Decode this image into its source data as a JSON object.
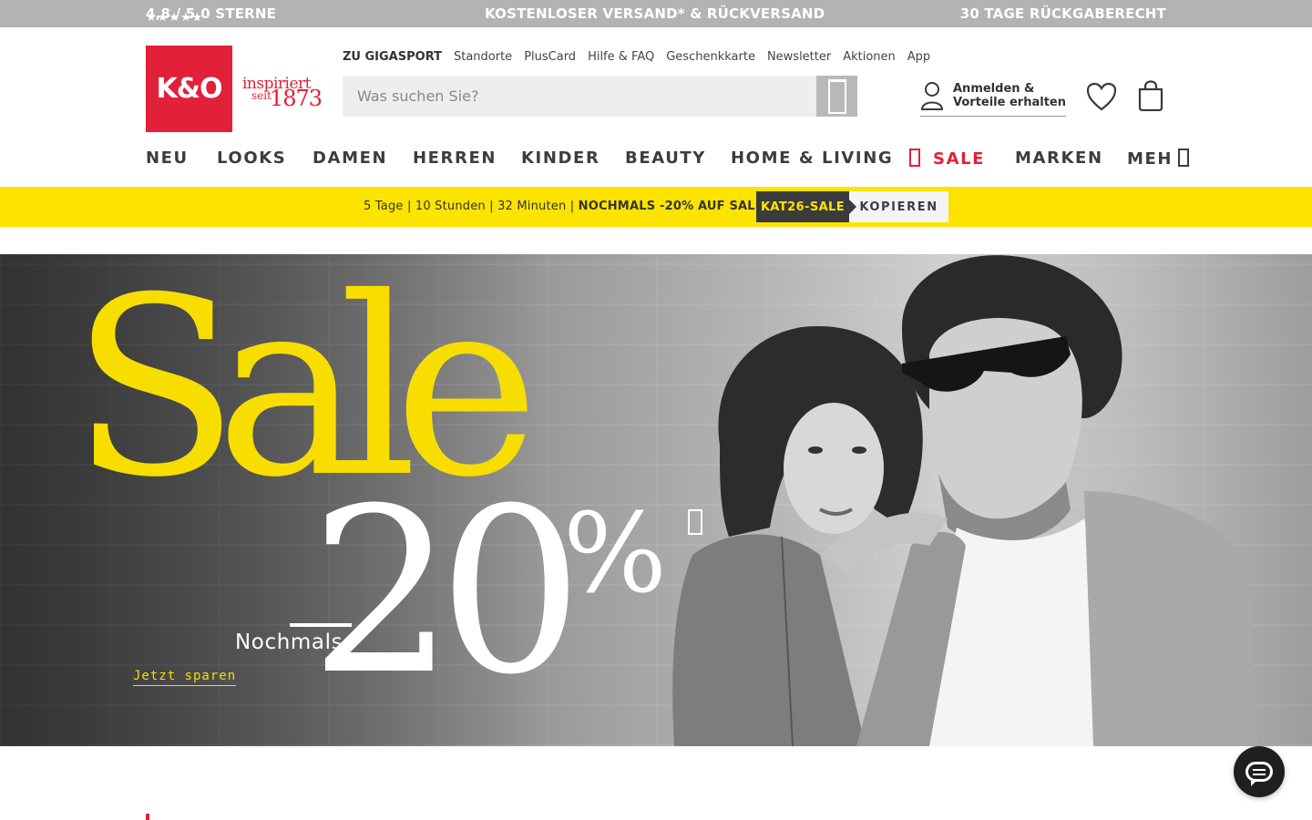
{
  "topbar": {
    "stars": "★★★★★",
    "rating": "4,8 / 5,0 STERNE",
    "shipping": "KOSTENLOSER VERSAND* & RÜCKVERSAND",
    "returns": "30 TAGE RÜCKGABERECHT",
    "background": "#b3b3b3"
  },
  "brand": {
    "logo_text": "K&O",
    "tagline_1": "inspiriert",
    "tagline_2": "seit",
    "tagline_year": "1873",
    "color": "#e2203a"
  },
  "servicenav": {
    "items": [
      "ZU GIGASPORT",
      "Standorte",
      "PlusCard",
      "Hilfe & FAQ",
      "Geschenkkarte",
      "Newsletter",
      "Aktionen",
      "App"
    ]
  },
  "search": {
    "placeholder": "Was suchen Sie?",
    "icon": "search-icon"
  },
  "account": {
    "line1": "Anmelden &",
    "line2": "Vorteile erhalten",
    "icon": "user-icon"
  },
  "header_icons": {
    "wishlist": "heart-icon",
    "cart": "shopping-bag-icon"
  },
  "mainnav": {
    "neu": "NEU",
    "looks": "LOOKS",
    "damen": "DAMEN",
    "herren": "HERREN",
    "kinder": "KINDER",
    "beauty": "BEAUTY",
    "home": "HOME & LIVING",
    "sale": "SALE",
    "marken": "MARKEN",
    "more": "MEH"
  },
  "promo": {
    "countdown": "5 Tage | 10 Stunden | 32 Minuten | ",
    "headline": "NOCHMALS -20% AUF SALE",
    "code": "KAT26-SALE",
    "copy_label": "KOPIEREN",
    "background": "#fce400"
  },
  "hero": {
    "title": "Sale",
    "again": "Nochmals",
    "discount": "20",
    "percent": "%",
    "cta": "Jetzt sparen",
    "accent": "#f7de00"
  }
}
